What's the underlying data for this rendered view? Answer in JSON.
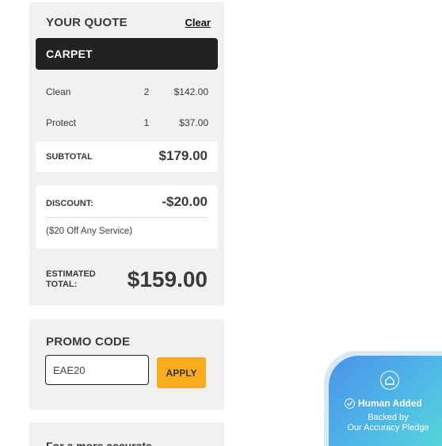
{
  "quote": {
    "title": "YOUR QUOTE",
    "clear_label": "Clear",
    "category": "CARPET",
    "items": [
      {
        "name": "Clean",
        "qty": "2",
        "price": "$142.00"
      },
      {
        "name": "Protect",
        "qty": "1",
        "price": "$37.00"
      }
    ],
    "subtotal_label": "SUBTOTAL",
    "subtotal_value": "$179.00",
    "discount_label": "DISCOUNT:",
    "discount_value": "-$20.00",
    "discount_note": "($20 Off Any Service)",
    "estimated_label_line1": "ESTIMATED",
    "estimated_label_line2": "TOTAL:",
    "estimated_value": "$159.00"
  },
  "promo": {
    "title": "PROMO CODE",
    "input_value": "EAE20",
    "apply_label": "APPLY"
  },
  "more_info": {
    "text": "For a more accurate"
  },
  "badge": {
    "line1": "Human Added",
    "line2": "Backed by",
    "line3": "Our Accuracy Pledge",
    "icon": "house-icon",
    "colors": {
      "start": "#4a93e8",
      "end": "#56d8d8"
    }
  },
  "colors": {
    "accent": "#f9ad1b",
    "dark_bar": "#222222",
    "card_bg": "#f1f1f1"
  }
}
